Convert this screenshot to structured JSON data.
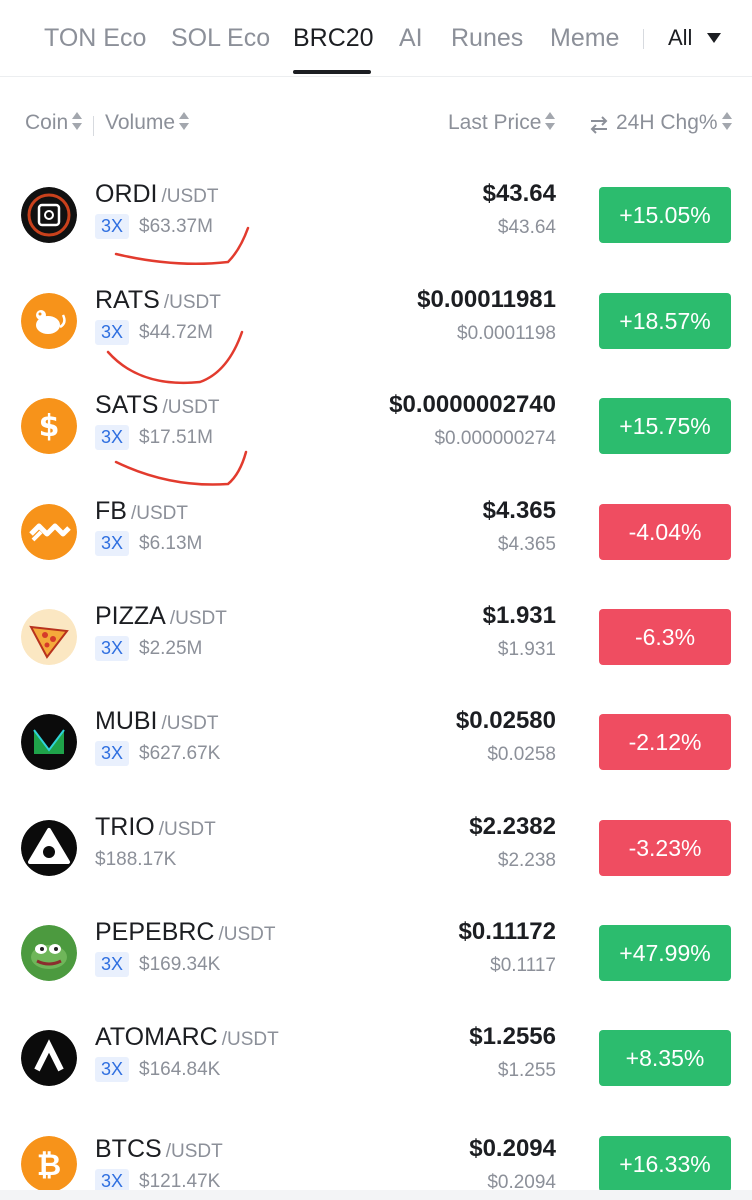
{
  "tabs": [
    {
      "label": "TON Eco",
      "active": false
    },
    {
      "label": "SOL Eco",
      "active": false
    },
    {
      "label": "BRC20",
      "active": true
    },
    {
      "label": "AI",
      "active": false
    },
    {
      "label": "Runes",
      "active": false
    },
    {
      "label": "Meme",
      "active": false
    }
  ],
  "filter": {
    "label": "All"
  },
  "columns": {
    "coin": "Coin",
    "volume": "Volume",
    "last_price": "Last Price",
    "change": "24H Chg%"
  },
  "colors": {
    "up": "#2cbc6e",
    "down": "#ef4d61",
    "leverage_text": "#2f6fe0",
    "annotation": "#e23b2e"
  },
  "rows": [
    {
      "symbol": "ORDI",
      "pair": "/USDT",
      "leverage": "3X",
      "volume": "$63.37M",
      "price": "$43.64",
      "price_sub": "$43.64",
      "change": "+15.05%",
      "direction": "up",
      "icon": "ordi-icon"
    },
    {
      "symbol": "RATS",
      "pair": "/USDT",
      "leverage": "3X",
      "volume": "$44.72M",
      "price": "$0.00011981",
      "price_sub": "$0.0001198",
      "change": "+18.57%",
      "direction": "up",
      "icon": "rats-icon"
    },
    {
      "symbol": "SATS",
      "pair": "/USDT",
      "leverage": "3X",
      "volume": "$17.51M",
      "price": "$0.0000002740",
      "price_sub": "$0.000000274",
      "change": "+15.75%",
      "direction": "up",
      "icon": "sats-icon"
    },
    {
      "symbol": "FB",
      "pair": "/USDT",
      "leverage": "3X",
      "volume": "$6.13M",
      "price": "$4.365",
      "price_sub": "$4.365",
      "change": "-4.04%",
      "direction": "down",
      "icon": "fb-icon"
    },
    {
      "symbol": "PIZZA",
      "pair": "/USDT",
      "leverage": "3X",
      "volume": "$2.25M",
      "price": "$1.931",
      "price_sub": "$1.931",
      "change": "-6.3%",
      "direction": "down",
      "icon": "pizza-icon"
    },
    {
      "symbol": "MUBI",
      "pair": "/USDT",
      "leverage": "3X",
      "volume": "$627.67K",
      "price": "$0.02580",
      "price_sub": "$0.0258",
      "change": "-2.12%",
      "direction": "down",
      "icon": "mubi-icon"
    },
    {
      "symbol": "TRIO",
      "pair": "/USDT",
      "leverage": "",
      "volume": "$188.17K",
      "price": "$2.2382",
      "price_sub": "$2.238",
      "change": "-3.23%",
      "direction": "down",
      "icon": "trio-icon"
    },
    {
      "symbol": "PEPEBRC",
      "pair": "/USDT",
      "leverage": "3X",
      "volume": "$169.34K",
      "price": "$0.11172",
      "price_sub": "$0.1117",
      "change": "+47.99%",
      "direction": "up",
      "icon": "pepe-frog-icon"
    },
    {
      "symbol": "ATOMARC",
      "pair": "/USDT",
      "leverage": "3X",
      "volume": "$164.84K",
      "price": "$1.2556",
      "price_sub": "$1.255",
      "change": "+8.35%",
      "direction": "up",
      "icon": "atomarc-icon"
    },
    {
      "symbol": "BTCS",
      "pair": "/USDT",
      "leverage": "3X",
      "volume": "$121.47K",
      "price": "$0.2094",
      "price_sub": "$0.2094",
      "change": "+16.33%",
      "direction": "up",
      "icon": "btcs-icon"
    }
  ]
}
